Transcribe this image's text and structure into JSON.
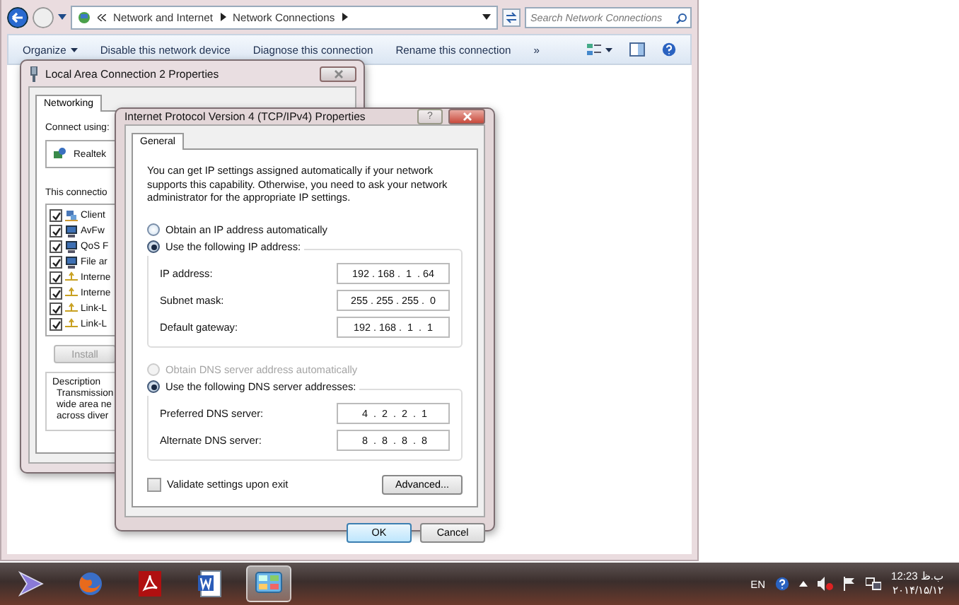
{
  "explorer": {
    "breadcrumb": [
      "Network and Internet",
      "Network Connections"
    ],
    "search": {
      "placeholder": "Search Network Connections"
    },
    "toolbar": [
      {
        "label": "Organize",
        "dropdown": true
      },
      {
        "label": "Disable this network device",
        "dropdown": false
      },
      {
        "label": "Diagnose this connection",
        "dropdown": false
      },
      {
        "label": "Rename this connection",
        "dropdown": false
      },
      {
        "label": "»",
        "dropdown": false
      }
    ]
  },
  "lan_properties": {
    "title": "Local Area Connection 2 Properties",
    "tabs": [
      {
        "label": "Networking",
        "selected": true
      }
    ],
    "connect_using_label": "Connect using:",
    "adapter": "Realtek",
    "items_label": "This connectio",
    "items": [
      {
        "kind": "client",
        "label": "Client",
        "checked": true
      },
      {
        "kind": "service",
        "label": "AvFw",
        "checked": true
      },
      {
        "kind": "service",
        "label": "QoS F",
        "checked": true
      },
      {
        "kind": "service",
        "label": "File ar",
        "checked": true
      },
      {
        "kind": "protocol",
        "label": "Interne",
        "checked": true
      },
      {
        "kind": "protocol",
        "label": "Interne",
        "checked": true
      },
      {
        "kind": "protocol",
        "label": "Link-L",
        "checked": true
      },
      {
        "kind": "protocol",
        "label": "Link-L",
        "checked": true
      }
    ],
    "install_button": "Install",
    "description_label": "Description",
    "description_lines": [
      "Transmission",
      "wide area ne",
      "across diver"
    ]
  },
  "ipv4_dialog": {
    "title": "Internet Protocol Version 4 (TCP/IPv4) Properties",
    "help_button": "?",
    "tabs": [
      {
        "label": "General",
        "selected": true
      }
    ],
    "intro": "You can get IP settings assigned automatically if your network supports this capability. Otherwise, you need to ask your network administrator for the appropriate IP settings.",
    "ip_modes": [
      {
        "label": "Obtain an IP address automatically",
        "selected": false,
        "disabled": false
      },
      {
        "label": "Use the following IP address:",
        "selected": true,
        "disabled": false
      }
    ],
    "ip_fields": [
      {
        "label": "IP address:",
        "value": "192 . 168 .  1  . 64"
      },
      {
        "label": "Subnet mask:",
        "value": "255 . 255 . 255 .  0"
      },
      {
        "label": "Default gateway:",
        "value": "192 . 168 .  1  .  1"
      }
    ],
    "dns_modes": [
      {
        "label": "Obtain DNS server address automatically",
        "selected": false,
        "disabled": true
      },
      {
        "label": "Use the following DNS server addresses:",
        "selected": true,
        "disabled": false
      }
    ],
    "dns_fields": [
      {
        "label": "Preferred DNS server:",
        "value": " 4  .  2  .  2  .  1"
      },
      {
        "label": "Alternate DNS server:",
        "value": " 8  .  8  .  8  .  8"
      }
    ],
    "validate": {
      "label": "Validate settings upon exit",
      "checked": false
    },
    "advanced_button": "Advanced...",
    "ok_button": "OK",
    "cancel_button": "Cancel"
  },
  "taskbar": {
    "apps": [
      {
        "kind": "media",
        "selected": false
      },
      {
        "kind": "browser",
        "selected": false
      },
      {
        "kind": "pdf",
        "selected": false
      },
      {
        "kind": "word",
        "selected": false
      },
      {
        "kind": "control-panel",
        "selected": true
      }
    ],
    "language": "EN",
    "clock_time": "ب.ظ 12:23",
    "clock_date": "۲۰۱۴/۱۵/۱۲"
  }
}
